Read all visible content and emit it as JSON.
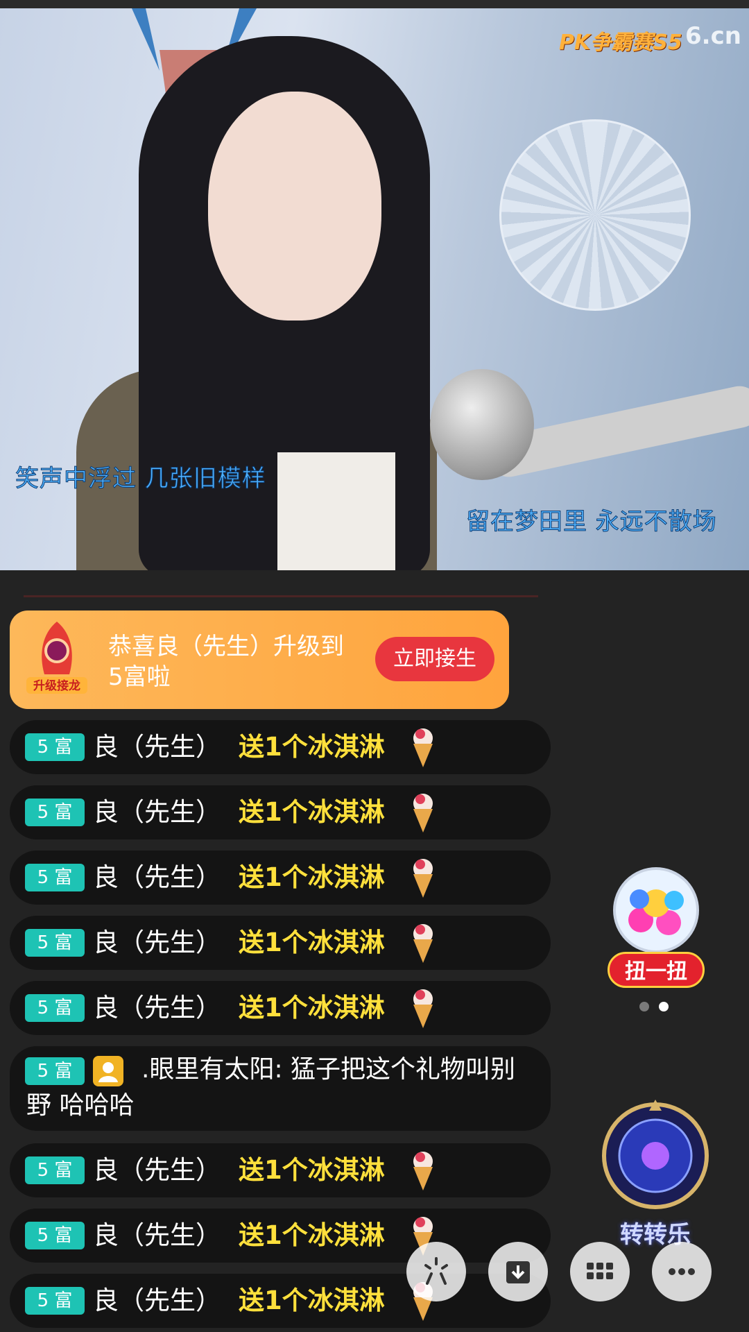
{
  "video": {
    "brand_badge": "PK争霸赛S5",
    "brand_logo": "6.cn",
    "lyric_left": "笑声中浮过 几张旧模样",
    "lyric_right": "留在梦田里 永远不散场"
  },
  "upgrade_banner": {
    "icon_label": "升级接龙",
    "text": "恭喜良（先生）升级到5富啦",
    "button": "立即接生"
  },
  "chat": {
    "gift_messages": [
      {
        "badge": "5 富",
        "user": "良（先生）",
        "gift": "送1个冰淇淋"
      },
      {
        "badge": "5 富",
        "user": "良（先生）",
        "gift": "送1个冰淇淋"
      },
      {
        "badge": "5 富",
        "user": "良（先生）",
        "gift": "送1个冰淇淋"
      },
      {
        "badge": "5 富",
        "user": "良（先生）",
        "gift": "送1个冰淇淋"
      },
      {
        "badge": "5 富",
        "user": "良（先生）",
        "gift": "送1个冰淇淋"
      }
    ],
    "text_message": {
      "badge": "5 富",
      "user": ".眼里有太阳:",
      "text": "猛子把这个礼物叫别野 哈哈哈"
    },
    "gift_messages_2": [
      {
        "badge": "5 富",
        "user": "良（先生）",
        "gift": "送1个冰淇淋"
      },
      {
        "badge": "5 富",
        "user": "良（先生）",
        "gift": "送1个冰淇淋"
      },
      {
        "badge": "5 富",
        "user": "良（先生）",
        "gift": "送1个冰淇淋"
      }
    ]
  },
  "side": {
    "gacha_label": "扭一扭",
    "wheel_label": "转转乐"
  },
  "icons": [
    "share-icon",
    "download-icon",
    "apps-grid-icon",
    "more-icon"
  ],
  "colors": {
    "badge": "#1ec3b4",
    "gift_text": "#ffe03c",
    "banner": "#ffa43d",
    "button": "#e8363e"
  }
}
